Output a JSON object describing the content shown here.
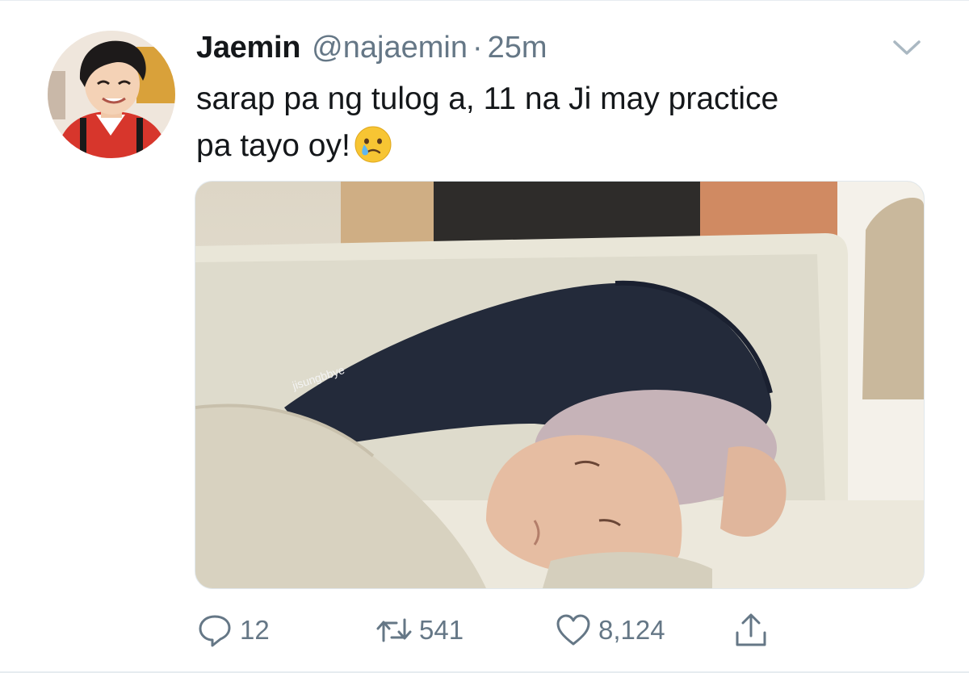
{
  "tweet": {
    "display_name": "Jaemin",
    "handle": "@najaemin",
    "separator": "·",
    "time": "25m",
    "text_line_1": "sarap pa ng tulog a, 11 na Ji may practice",
    "text_line_2": "pa tayo oy!",
    "emoji": "crying-face",
    "media": {
      "watermark": "jisungbbye"
    }
  },
  "actions": {
    "reply_count": "12",
    "retweet_count": "541",
    "like_count": "8,124"
  },
  "colors": {
    "text": "#14171a",
    "secondary": "#657786",
    "border": "#e1e8ed"
  }
}
